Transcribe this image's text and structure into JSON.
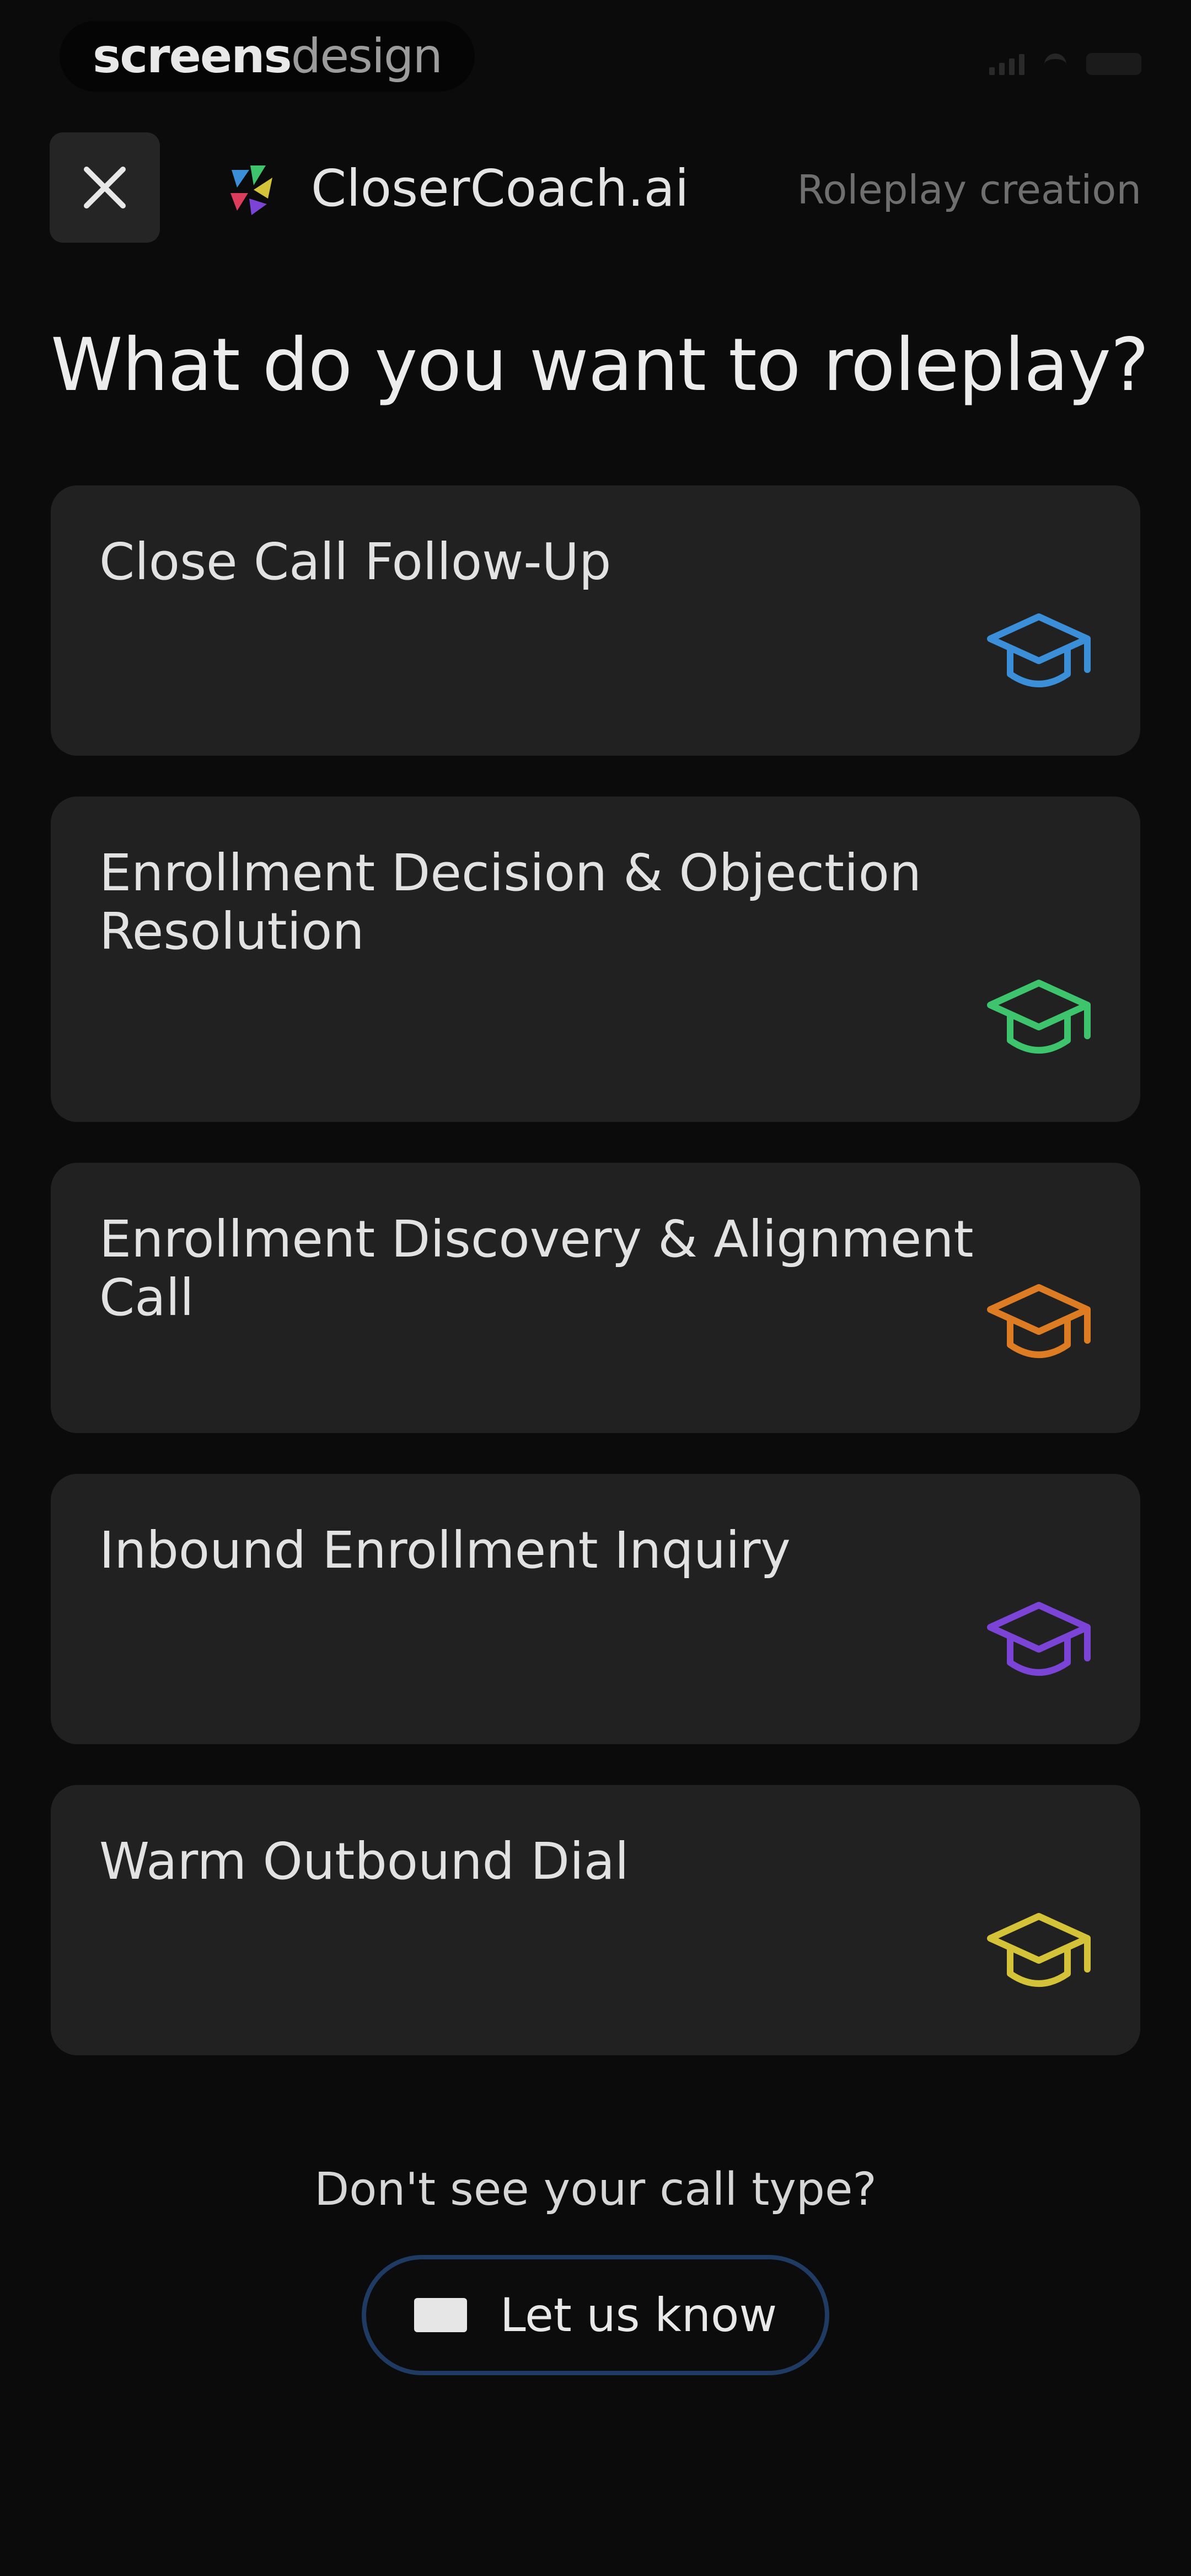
{
  "watermark": {
    "part1": "screens",
    "part2": "design"
  },
  "header": {
    "brand_name": "CloserCoach.ai",
    "context": "Roleplay creation"
  },
  "page": {
    "title": "What do you want to roleplay?"
  },
  "options": [
    {
      "title": "Close Call Follow-Up",
      "icon": "graduation-cap-icon",
      "color": "#3b8fd9"
    },
    {
      "title": "Enrollment Decision & Objection Resolution",
      "icon": "graduation-cap-icon",
      "color": "#3ec46d"
    },
    {
      "title": "Enrollment Discovery & Alignment Call",
      "icon": "graduation-cap-icon",
      "color": "#dd7c22"
    },
    {
      "title": "Inbound Enrollment Inquiry",
      "icon": "graduation-cap-icon",
      "color": "#7b44d6"
    },
    {
      "title": "Warm Outbound Dial",
      "icon": "graduation-cap-icon",
      "color": "#d4c338"
    }
  ],
  "footer": {
    "prompt": "Don't see your call type?",
    "button_label": "Let us know",
    "button_icon": "mail-icon",
    "button_border_color": "#1f3b63"
  },
  "colors": {
    "background": "#0b0b0b",
    "card": "#212121"
  }
}
